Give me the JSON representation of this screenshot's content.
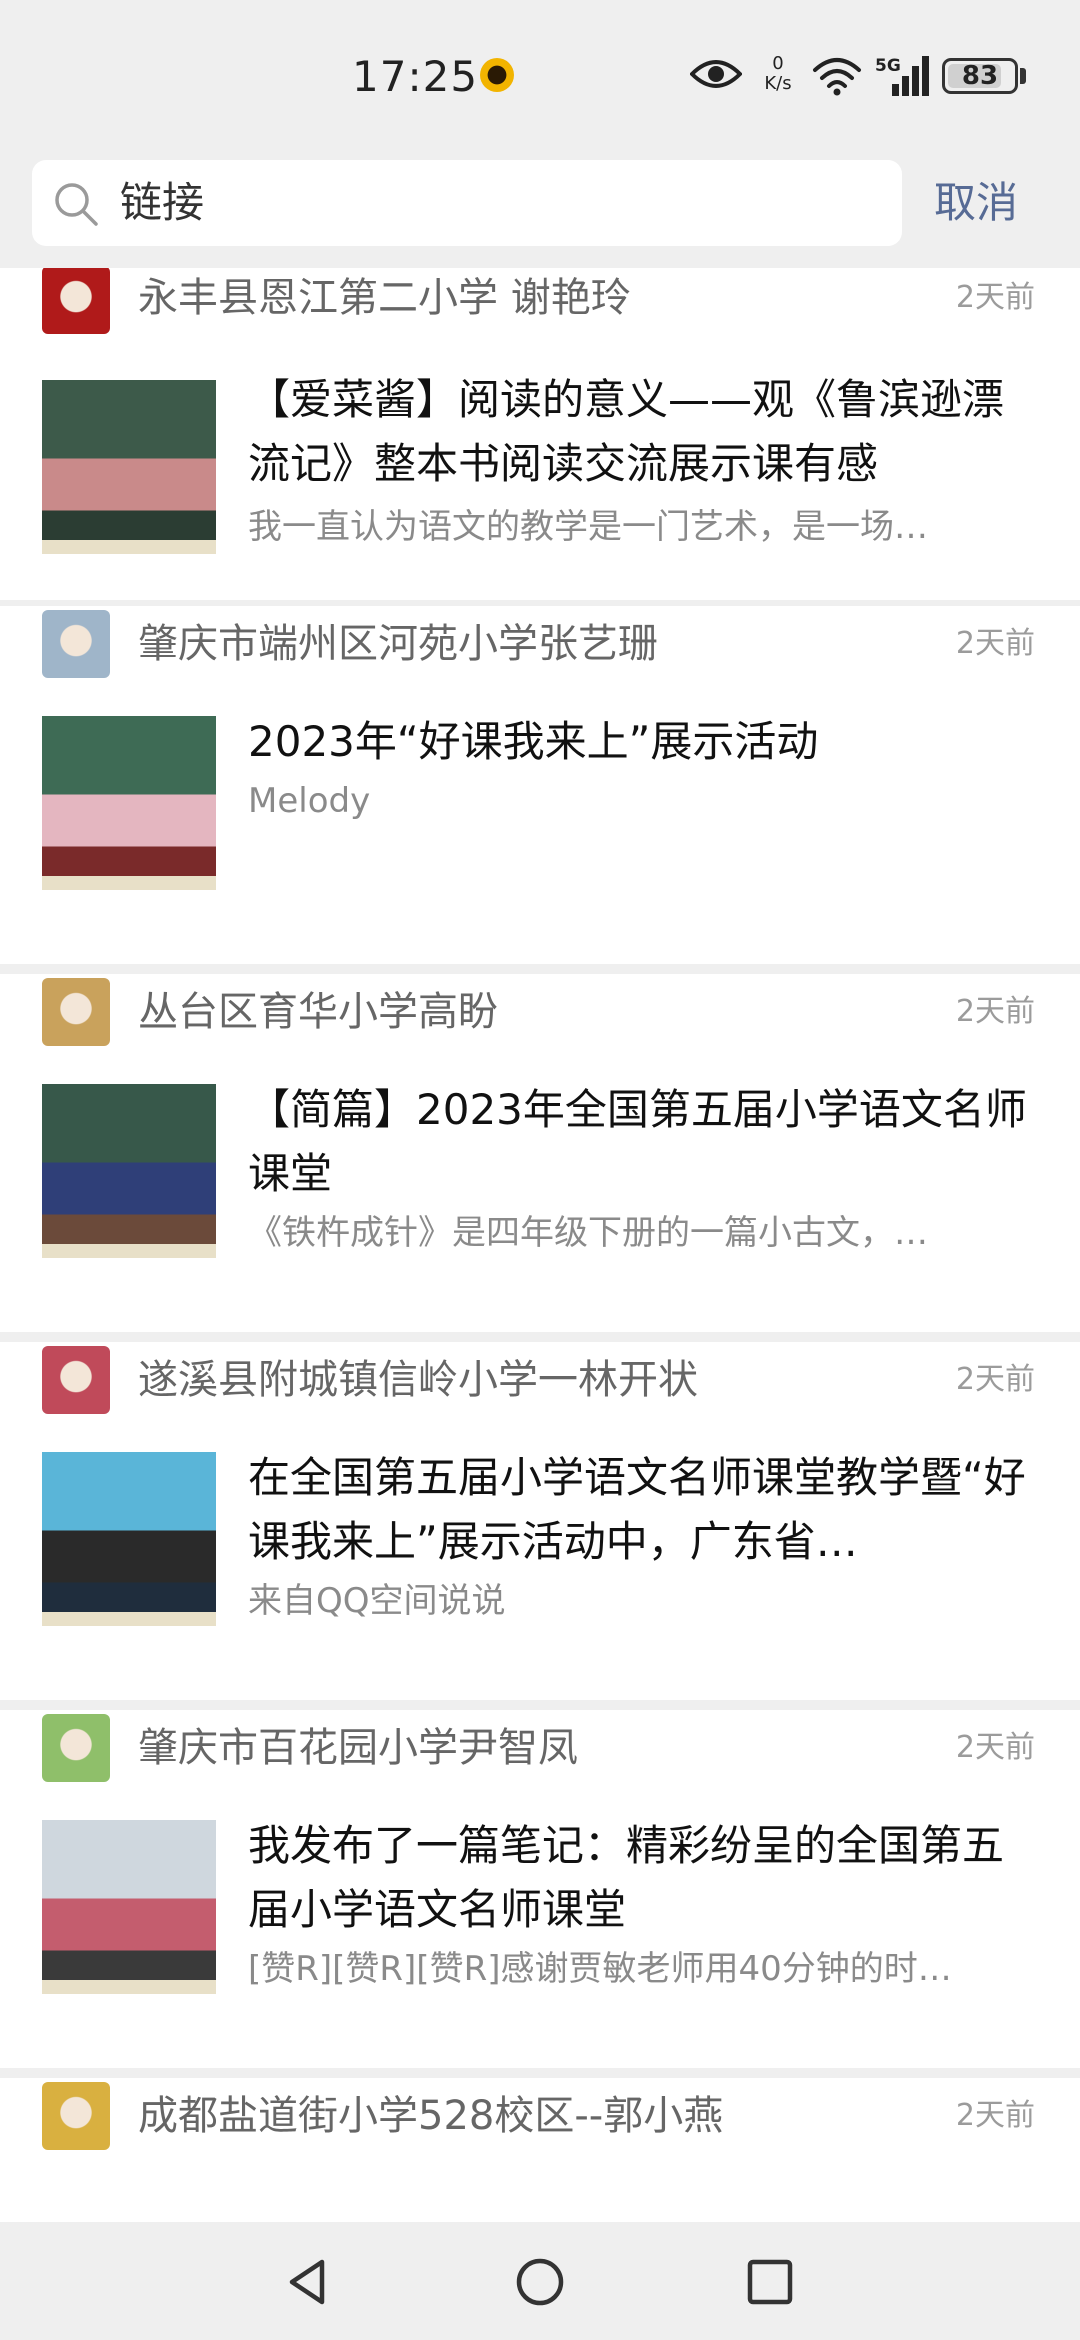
{
  "status": {
    "time": "17:25",
    "speed_top": "0",
    "speed_unit": "K/s",
    "network": "5G",
    "battery": "83",
    "battery_level": 0.83
  },
  "search": {
    "query": "链接",
    "cancel_label": "取消"
  },
  "feed": [
    {
      "author": "永丰县恩江第二小学 谢艳玲",
      "time": "2天前",
      "title": "【爱菜酱】阅读的意义——观《鲁滨逊漂流记》整本书阅读交流展示课有感",
      "desc": "我一直认为语文的教学是一门艺术，是一场…",
      "avatar_color": "#b01a1a",
      "thumb_colors": [
        "#3d5a4a",
        "#c98a8a",
        "#2b3d33"
      ]
    },
    {
      "author": "肇庆市端州区河苑小学张艺珊",
      "time": "2天前",
      "title": "2023年“好课我来上”展示活动",
      "desc": "Melody",
      "avatar_color": "#9fb5c9",
      "thumb_colors": [
        "#3e6b55",
        "#e4b6c0",
        "#7a2a2a"
      ]
    },
    {
      "author": "丛台区育华小学高盼",
      "time": "2天前",
      "title": "【简篇】2023年全国第五届小学语文名师课堂",
      "desc": "《铁杵成针》是四年级下册的一篇小古文，…",
      "avatar_color": "#c9a25c",
      "thumb_colors": [
        "#37584a",
        "#2f3f78",
        "#6b4a3a"
      ]
    },
    {
      "author": "遂溪县附城镇信岭小学一林开状",
      "time": "2天前",
      "title": "在全国第五届小学语文名师课堂教学暨“好课我来上”展示活动中，广东省…",
      "desc": "来自QQ空间说说",
      "avatar_color": "#c04a5a",
      "thumb_colors": [
        "#5ab5d8",
        "#2a2a2a",
        "#1f2d3d"
      ]
    },
    {
      "author": "肇庆市百花园小学尹智凤",
      "time": "2天前",
      "title": "我发布了一篇笔记：精彩纷呈的全国第五届小学语文名师课堂",
      "desc": "[赞R][赞R][赞R]感谢贾敏老师用40分钟的时…",
      "avatar_color": "#8fbf6a",
      "thumb_colors": [
        "#cfd7de",
        "#c45d6e",
        "#3a3a3a"
      ]
    },
    {
      "author": "成都盐道街小学528校区--郭小燕",
      "time": "2天前",
      "title": "",
      "desc": "",
      "avatar_color": "#d9b040",
      "thumb_colors": [
        "#cccccc",
        "#cccccc",
        "#cccccc"
      ]
    }
  ]
}
